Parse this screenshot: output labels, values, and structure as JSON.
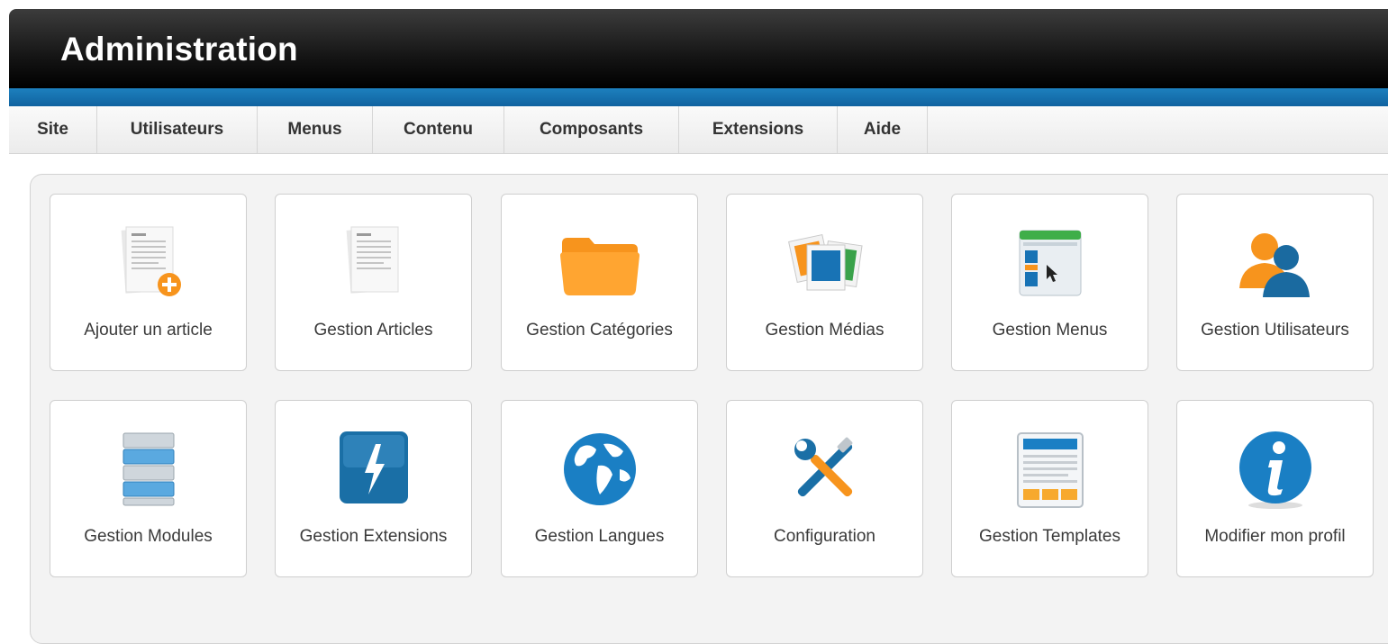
{
  "header": {
    "title": "Administration"
  },
  "menu": [
    {
      "id": "site",
      "label": "Site"
    },
    {
      "id": "utilisateurs",
      "label": "Utilisateurs"
    },
    {
      "id": "menus",
      "label": "Menus"
    },
    {
      "id": "contenu",
      "label": "Contenu"
    },
    {
      "id": "composants",
      "label": "Composants"
    },
    {
      "id": "extensions",
      "label": "Extensions"
    },
    {
      "id": "aide",
      "label": "Aide"
    }
  ],
  "tiles": [
    {
      "label": "Ajouter un article",
      "icon": "article-add-icon"
    },
    {
      "label": "Gestion Articles",
      "icon": "article-icon"
    },
    {
      "label": "Gestion Catégories",
      "icon": "folder-icon"
    },
    {
      "label": "Gestion Médias",
      "icon": "media-icon"
    },
    {
      "label": "Gestion Menus",
      "icon": "menu-window-icon"
    },
    {
      "label": "Gestion Utilisateurs",
      "icon": "users-icon"
    },
    {
      "label": "Gestion Modules",
      "icon": "modules-icon"
    },
    {
      "label": "Gestion Extensions",
      "icon": "extensions-icon"
    },
    {
      "label": "Gestion Langues",
      "icon": "globe-icon"
    },
    {
      "label": "Configuration",
      "icon": "tools-icon"
    },
    {
      "label": "Gestion Templates",
      "icon": "template-icon"
    },
    {
      "label": "Modifier mon profil",
      "icon": "info-icon"
    }
  ],
  "colors": {
    "accent_blue": "#1873b5",
    "orange": "#f7941d",
    "header_dark": "#111111"
  }
}
